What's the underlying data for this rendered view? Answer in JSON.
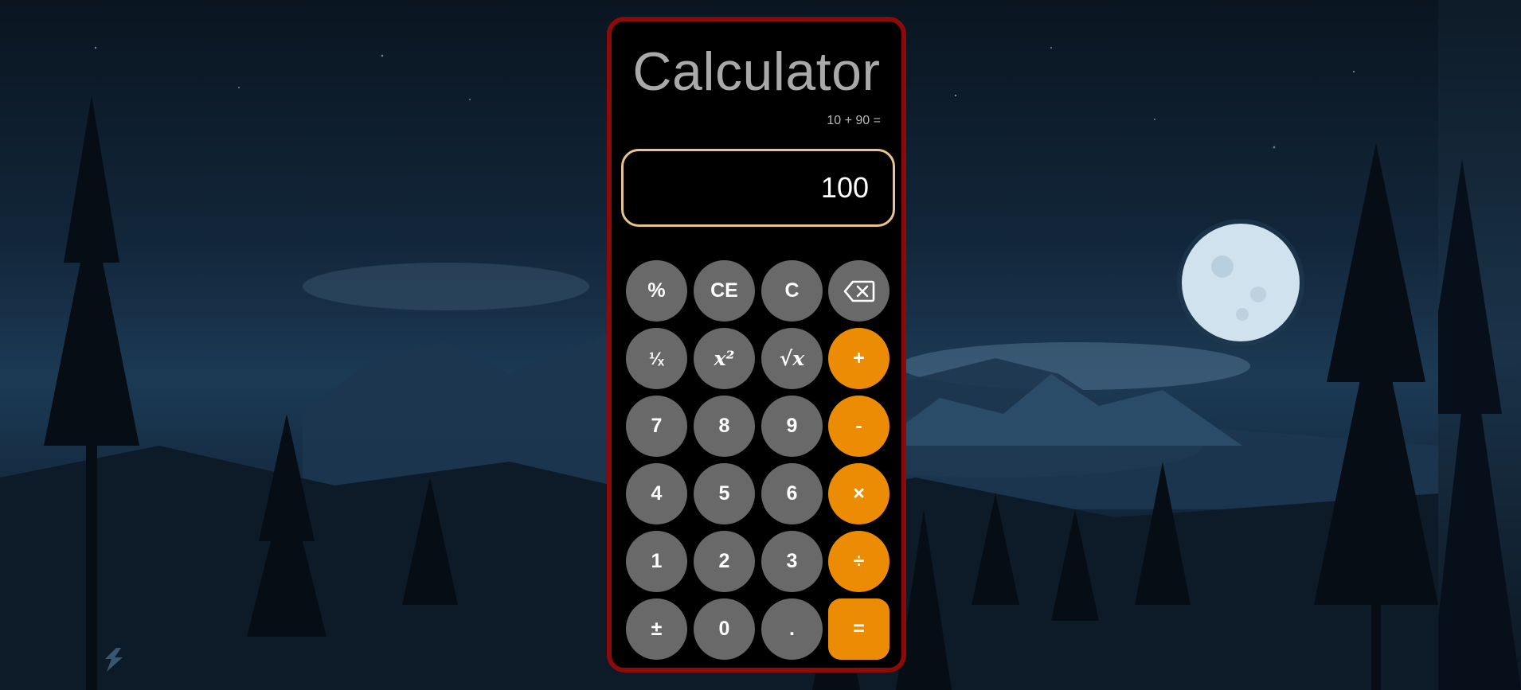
{
  "title": "Calculator",
  "expression": "10 + 90 =",
  "display": "100",
  "keys": {
    "percent": "%",
    "ce": "CE",
    "c": "C",
    "reciprocal": "¹⁄ₓ",
    "square": "x²",
    "sqrt": "√x",
    "plus": "+",
    "seven": "7",
    "eight": "8",
    "nine": "9",
    "minus": "-",
    "four": "4",
    "five": "5",
    "six": "6",
    "multiply": "×",
    "one": "1",
    "two": "2",
    "three": "3",
    "divide": "÷",
    "negate": "±",
    "zero": "0",
    "decimal": ".",
    "equals": "="
  },
  "icons": {
    "backspace": "backspace-icon",
    "logo": "app-logo-icon"
  },
  "colors": {
    "frame_border": "#8b0a0a",
    "display_border": "#e9c28e",
    "key_gray": "#696969",
    "key_orange": "#ec8c05",
    "title_text": "#a9a9a9"
  }
}
